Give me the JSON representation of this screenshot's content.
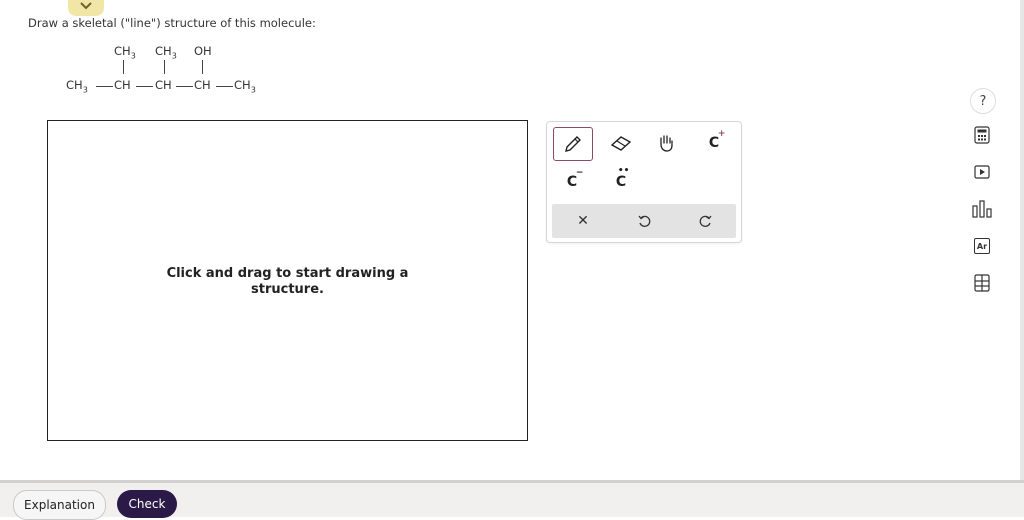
{
  "prompt": "Draw a skeletal (\"line\") structure of this molecule:",
  "molecule": {
    "top_labels": [
      "CH3",
      "CH3",
      "OH"
    ],
    "chain": [
      "CH3",
      "CH",
      "CH",
      "CH",
      "CH3"
    ]
  },
  "canvas": {
    "hint_line1": "Click and drag to start drawing a",
    "hint_line2": "structure."
  },
  "toolbox": {
    "tools": [
      {
        "name": "pencil-icon",
        "selected": true
      },
      {
        "name": "eraser-icon",
        "selected": false
      },
      {
        "name": "hand-icon",
        "selected": false
      },
      {
        "name": "carbocation-icon",
        "label": "C"
      },
      {
        "name": "carbanion-icon",
        "label": "C"
      },
      {
        "name": "lone-pair-icon",
        "label": "C"
      }
    ],
    "actions": [
      "clear-icon",
      "undo-icon",
      "redo-icon"
    ]
  },
  "right_rail": {
    "help_label": "?",
    "icons": [
      "calculator-icon",
      "video-icon",
      "chart-icon",
      "periodic-table-icon",
      "data-table-icon"
    ],
    "periodic_label": "Ar"
  },
  "bottom": {
    "explanation_label": "Explanation",
    "check_label": "Check"
  },
  "colors": {
    "check_bg": "#2b1a47",
    "selected_border": "#8b4a6b",
    "chevron_bg": "#f1e6a6"
  }
}
